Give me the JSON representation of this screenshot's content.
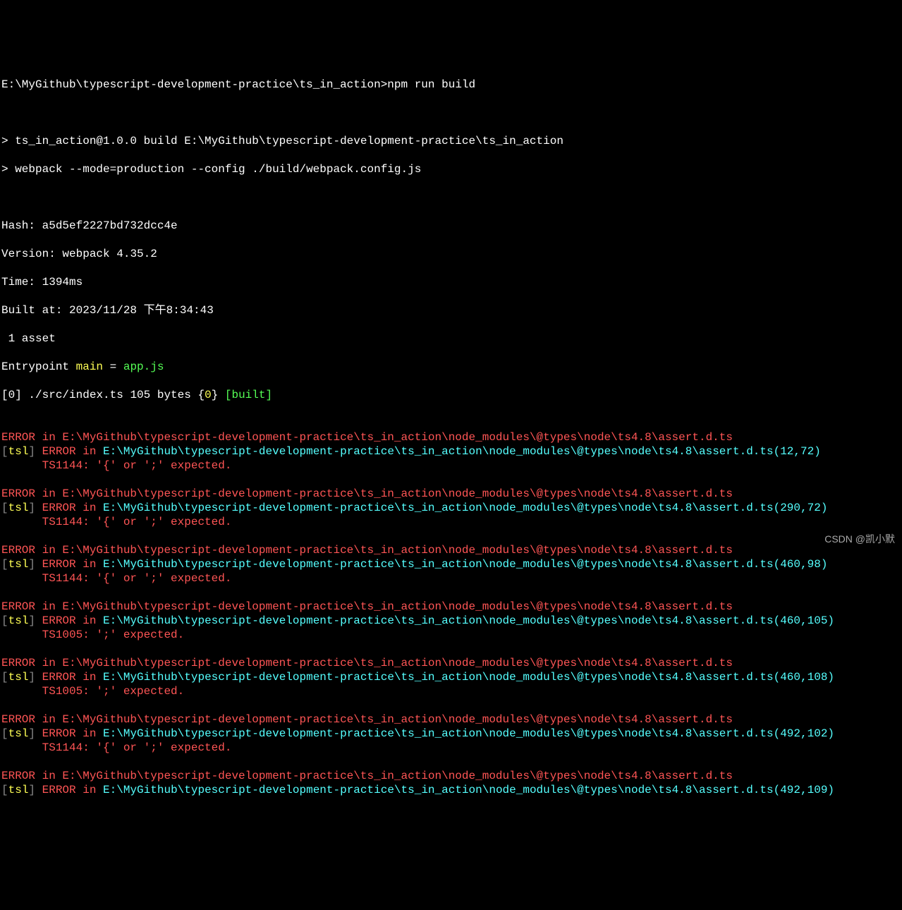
{
  "prompt": {
    "path": "E:\\MyGithub\\typescript-development-practice\\ts_in_action>",
    "command": "npm run build"
  },
  "script_lines": [
    "> ts_in_action@1.0.0 build E:\\MyGithub\\typescript-development-practice\\ts_in_action",
    "> webpack --mode=production --config ./build/webpack.config.js"
  ],
  "build_info": {
    "hash_label": "Hash: ",
    "hash": "a5d5ef2227bd732dcc4e",
    "version_label": "Version: ",
    "version": "webpack 4.35.2",
    "time_label": "Time: ",
    "time": "1394",
    "time_suffix": "ms",
    "built_at_label": "Built at: ",
    "built_at": "2023/11/28 下午8:34:43",
    "asset": " 1 asset",
    "entry_prefix": "Entrypoint ",
    "entry_name": "main",
    "entry_eq": " = ",
    "entry_file": "app.js",
    "module_lb": "[",
    "module_idx": "0",
    "module_rb": "] ",
    "module_path": "./src/index.ts",
    "module_mid": " 105 bytes {",
    "module_zero": "0",
    "module_close": "} ",
    "module_built": "[built]"
  },
  "errors": [
    {
      "header": "ERROR in E:\\MyGithub\\typescript-development-practice\\ts_in_action\\node_modules\\@types\\node\\ts4.8\\assert.d.ts",
      "tsl_lb": "[",
      "tsl": "tsl",
      "tsl_rb": "] ",
      "err_in": "ERROR in ",
      "path": "E:\\MyGithub\\typescript-development-practice\\ts_in_action\\node_modules\\@types\\node\\ts4.8\\assert.d.ts(12,72)",
      "msg": "      TS1144: '{' or ';' expected."
    },
    {
      "header": "ERROR in E:\\MyGithub\\typescript-development-practice\\ts_in_action\\node_modules\\@types\\node\\ts4.8\\assert.d.ts",
      "tsl_lb": "[",
      "tsl": "tsl",
      "tsl_rb": "] ",
      "err_in": "ERROR in ",
      "path": "E:\\MyGithub\\typescript-development-practice\\ts_in_action\\node_modules\\@types\\node\\ts4.8\\assert.d.ts(290,72)",
      "msg": "      TS1144: '{' or ';' expected."
    },
    {
      "header": "ERROR in E:\\MyGithub\\typescript-development-practice\\ts_in_action\\node_modules\\@types\\node\\ts4.8\\assert.d.ts",
      "tsl_lb": "[",
      "tsl": "tsl",
      "tsl_rb": "] ",
      "err_in": "ERROR in ",
      "path": "E:\\MyGithub\\typescript-development-practice\\ts_in_action\\node_modules\\@types\\node\\ts4.8\\assert.d.ts(460,98)",
      "msg": "      TS1144: '{' or ';' expected."
    },
    {
      "header": "ERROR in E:\\MyGithub\\typescript-development-practice\\ts_in_action\\node_modules\\@types\\node\\ts4.8\\assert.d.ts",
      "tsl_lb": "[",
      "tsl": "tsl",
      "tsl_rb": "] ",
      "err_in": "ERROR in ",
      "path": "E:\\MyGithub\\typescript-development-practice\\ts_in_action\\node_modules\\@types\\node\\ts4.8\\assert.d.ts(460,105)",
      "msg": "      TS1005: ';' expected."
    },
    {
      "header": "ERROR in E:\\MyGithub\\typescript-development-practice\\ts_in_action\\node_modules\\@types\\node\\ts4.8\\assert.d.ts",
      "tsl_lb": "[",
      "tsl": "tsl",
      "tsl_rb": "] ",
      "err_in": "ERROR in ",
      "path": "E:\\MyGithub\\typescript-development-practice\\ts_in_action\\node_modules\\@types\\node\\ts4.8\\assert.d.ts(460,108)",
      "msg": "      TS1005: ';' expected."
    },
    {
      "header": "ERROR in E:\\MyGithub\\typescript-development-practice\\ts_in_action\\node_modules\\@types\\node\\ts4.8\\assert.d.ts",
      "tsl_lb": "[",
      "tsl": "tsl",
      "tsl_rb": "] ",
      "err_in": "ERROR in ",
      "path": "E:\\MyGithub\\typescript-development-practice\\ts_in_action\\node_modules\\@types\\node\\ts4.8\\assert.d.ts(492,102)",
      "msg": "      TS1144: '{' or ';' expected."
    },
    {
      "header": "ERROR in E:\\MyGithub\\typescript-development-practice\\ts_in_action\\node_modules\\@types\\node\\ts4.8\\assert.d.ts",
      "tsl_lb": "[",
      "tsl": "tsl",
      "tsl_rb": "] ",
      "err_in": "ERROR in ",
      "path": "E:\\MyGithub\\typescript-development-practice\\ts_in_action\\node_modules\\@types\\node\\ts4.8\\assert.d.ts(492,109)",
      "msg": ""
    }
  ],
  "watermark": "CSDN @凯小默"
}
